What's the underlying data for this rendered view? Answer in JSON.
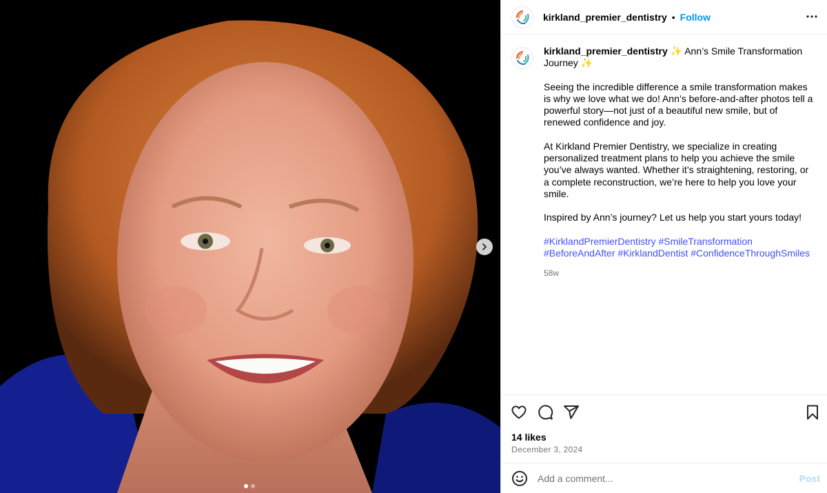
{
  "post": {
    "username": "kirkland_premier_dentistry",
    "follow_label": "Follow",
    "separator": "•",
    "more_icon": "more-horizontal-icon",
    "carousel": {
      "current_slide": 1,
      "total_slides": 2
    }
  },
  "caption": {
    "username": "kirkland_premier_dentistry",
    "title": "✨ Ann’s Smile Transformation Journey ✨",
    "paragraphs": [
      "Seeing the incredible difference a smile transformation makes is why we love what we do! Ann’s before-and-after photos tell a powerful story—not just of a beautiful new smile, but of renewed confidence and joy.",
      "At Kirkland Premier Dentistry, we specialize in creating personalized treatment plans to help you achieve the smile you’ve always wanted. Whether it’s straightening, restoring, or a complete reconstruction, we’re here to help you love your smile.",
      "Inspired by Ann’s journey? Let us help you start yours today!"
    ],
    "hashtags": [
      "#KirklandPremierDentistry",
      "#SmileTransformation",
      "#BeforeAndAfter",
      "#KirklandDentist",
      "#ConfidenceThroughSmiles"
    ],
    "timestamp": "58w"
  },
  "actions": {
    "likes": "14 likes",
    "date": "December 3, 2024",
    "icons": [
      "heart-icon",
      "comment-icon",
      "share-icon",
      "bookmark-icon"
    ]
  },
  "comment_box": {
    "placeholder": "Add a comment...",
    "post_label": "Post"
  },
  "colors": {
    "follow": "#0095f6",
    "hashtag": "#4150f7",
    "muted": "#737373",
    "post_disabled": "#b3dbff",
    "photo_background": "#000000"
  }
}
